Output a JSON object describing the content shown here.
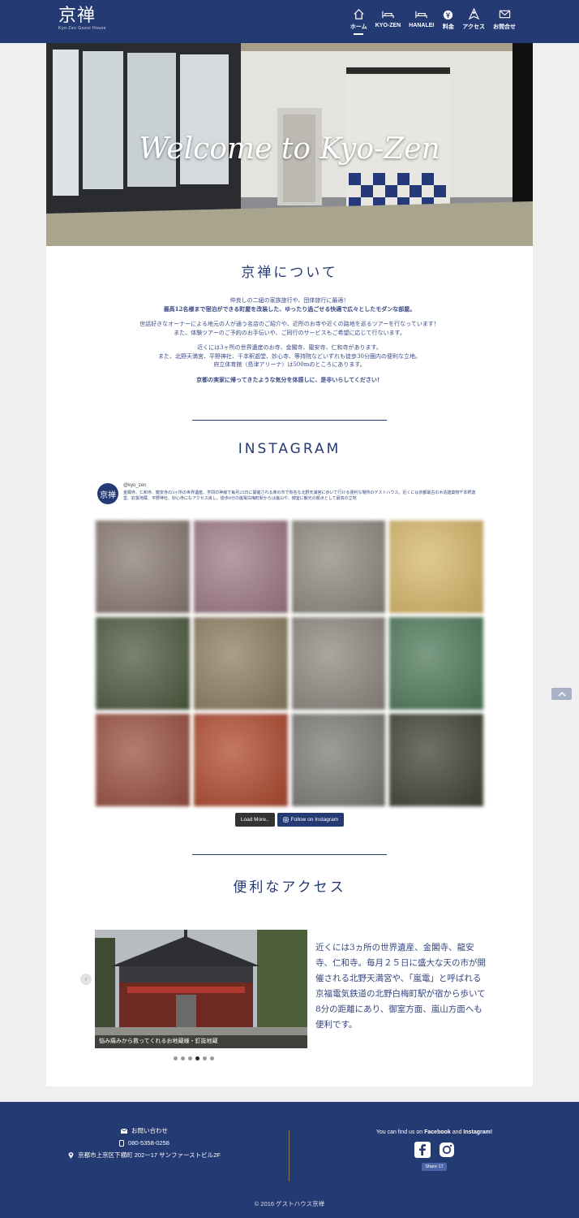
{
  "header": {
    "logo_kanji": "京禅",
    "logo_sub": "Kyo-Zen Guest House",
    "nav": [
      {
        "label": "ホーム",
        "icon": "home-icon",
        "active": true
      },
      {
        "label": "KYO-ZEN",
        "icon": "bed-icon",
        "active": false
      },
      {
        "label": "HANALEI",
        "icon": "bed-icon",
        "active": false
      },
      {
        "label": "料金",
        "icon": "yen-icon",
        "active": false
      },
      {
        "label": "アクセス",
        "icon": "map-pin-icon",
        "active": false
      },
      {
        "label": "お問合せ",
        "icon": "mail-icon",
        "active": false
      }
    ]
  },
  "hero": {
    "title": "Welcome to Kyo-Zen"
  },
  "about": {
    "title": "京禅について",
    "p1_l1": "仲良しの二組の家族旅行や、団体旅行に最適！",
    "p1_l2": "最高12名様まで宿泊ができる町屋を改装した、ゆったり過ごせる快適で広々としたモダンな部屋。",
    "p2_l1": "世話好きなオーナーによる地元の人が通う名店のご紹介や、近所のお寺や近くの路地を巡るツアーを行なっています！",
    "p2_l2": "また、体験ツアーのご予約のお手伝いや、ご同行のサービスもご希望に応じて行ないます。",
    "p3_l1": "近くには3ヶ所の世界遺産のお寺、金閣寺、龍安寺、仁和寺があります。",
    "p3_l2": "また、北野天満宮、平野神社、千本釈迦堂、妙心寺、等持院などいずれも徒歩30分圏内の便利な立地。",
    "p3_l3": "府立体育館（島津アリーナ）は500mのところにあります。",
    "p4": "京都の実家に帰ってきたような気分を体感しに、是非いらしてください！"
  },
  "instagram": {
    "title": "INSTAGRAM",
    "avatar": "京禅",
    "username": "@kyo_zen",
    "bio": "金閣寺、仁和寺、龍安寺の3ヶ所の世界遺産、学問の神様で毎月25日に開催される楽の市で有名な北野天満宮に歩いて行ける便利な場所のゲストハウス。近くには京都最古の木造建築物千本釈迦堂、釘抜地蔵、平野神社、妙心寺にもアクセス良し。徒歩8分の嵐電白梅町駅からは嵐山や、御室に観光の拠点として最高の立地",
    "load_more": "Load More..",
    "follow": "Follow on Instagram",
    "tile_colors": [
      "#8b7b74",
      "#a07a86",
      "#8d8a80",
      "#d8b86a",
      "#4f5a3f",
      "#8d7e62",
      "#8e8880",
      "#4f7a5a",
      "#9a5040",
      "#b04a30",
      "#7e7c78",
      "#3f4433"
    ]
  },
  "access": {
    "title": "便利なアクセス",
    "slide_caption": "悩み痛みから救ってくれるお地蔵様・釘抜地蔵",
    "text": "近くには3ヵ所の世界遺産、金閣寺、龍安寺、仁和寺。毎月２５日に盛大な天の市が開催される北野天満宮や、「嵐電」と呼ばれる京福電気鉄道の北野白梅町駅が宿から歩いて8分の距離にあり、御室方面、嵐山方面へも便利です。",
    "slide_count": 6,
    "active_slide": 3
  },
  "footer": {
    "contact_label": "お問い合わせ",
    "phone": "080-5358-0258",
    "address": "京都市上京区下横町 202ー17 サンファーストビル2F",
    "social_prefix": "You can find us on ",
    "social_fb": "Facebook",
    "social_and": " and ",
    "social_ig": "Instagram!",
    "share": "Share 17",
    "copyright": "© 2016 ゲストハウス京禅"
  }
}
